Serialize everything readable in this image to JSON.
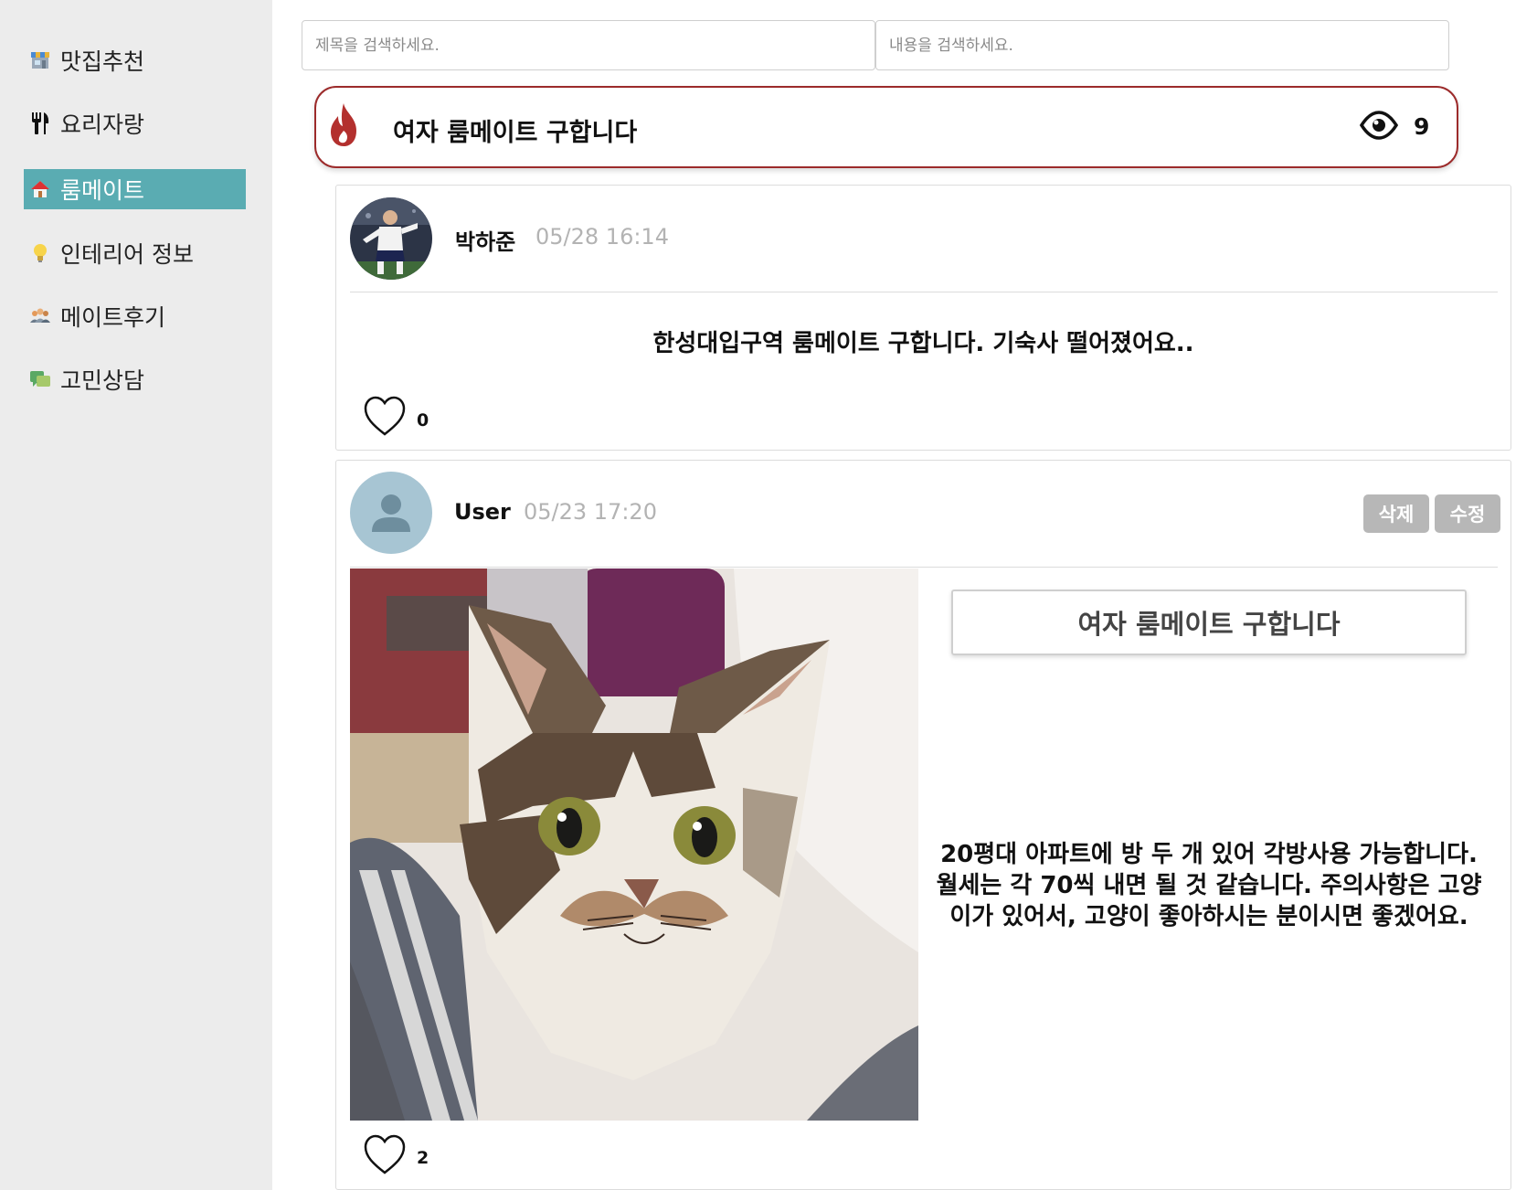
{
  "sidebar": {
    "items": [
      {
        "label": "맛집추천",
        "icon": "store-icon",
        "active": false
      },
      {
        "label": "요리자랑",
        "icon": "fork-knife-icon",
        "active": false
      },
      {
        "label": "룸메이트",
        "icon": "house-icon",
        "active": true
      },
      {
        "label": "인테리어 정보",
        "icon": "lightbulb-icon",
        "active": false
      },
      {
        "label": "메이트후기",
        "icon": "people-icon",
        "active": false
      },
      {
        "label": "고민상담",
        "icon": "chat-icon",
        "active": false
      }
    ],
    "active_color": "#5aacb2"
  },
  "search": {
    "title_placeholder": "제목을 검색하세요.",
    "content_placeholder": "내용을 검색하세요."
  },
  "banner": {
    "title": "여자 룸메이트 구합니다",
    "views": "9",
    "border_color": "#9c2b2b"
  },
  "comments": [
    {
      "author": "박하준",
      "timestamp": "05/28 16:14",
      "text": "한성대입구역 룸메이트 구합니다. 기숙사 떨어졌어요..",
      "likes": "0"
    }
  ],
  "post": {
    "author": "User",
    "timestamp": "05/23 17:20",
    "delete_label": "삭제",
    "edit_label": "수정",
    "title": "여자 룸메이트 구합니다",
    "body": "20평대 아파트에 방 두 개 있어 각방사용 가능합니다. 월세는 각 70씩 내면 될 것 같습니다. 주의사항은 고양이가 있어서, 고양이 좋아하시는 분이시면 좋겠어요.",
    "likes": "2"
  }
}
